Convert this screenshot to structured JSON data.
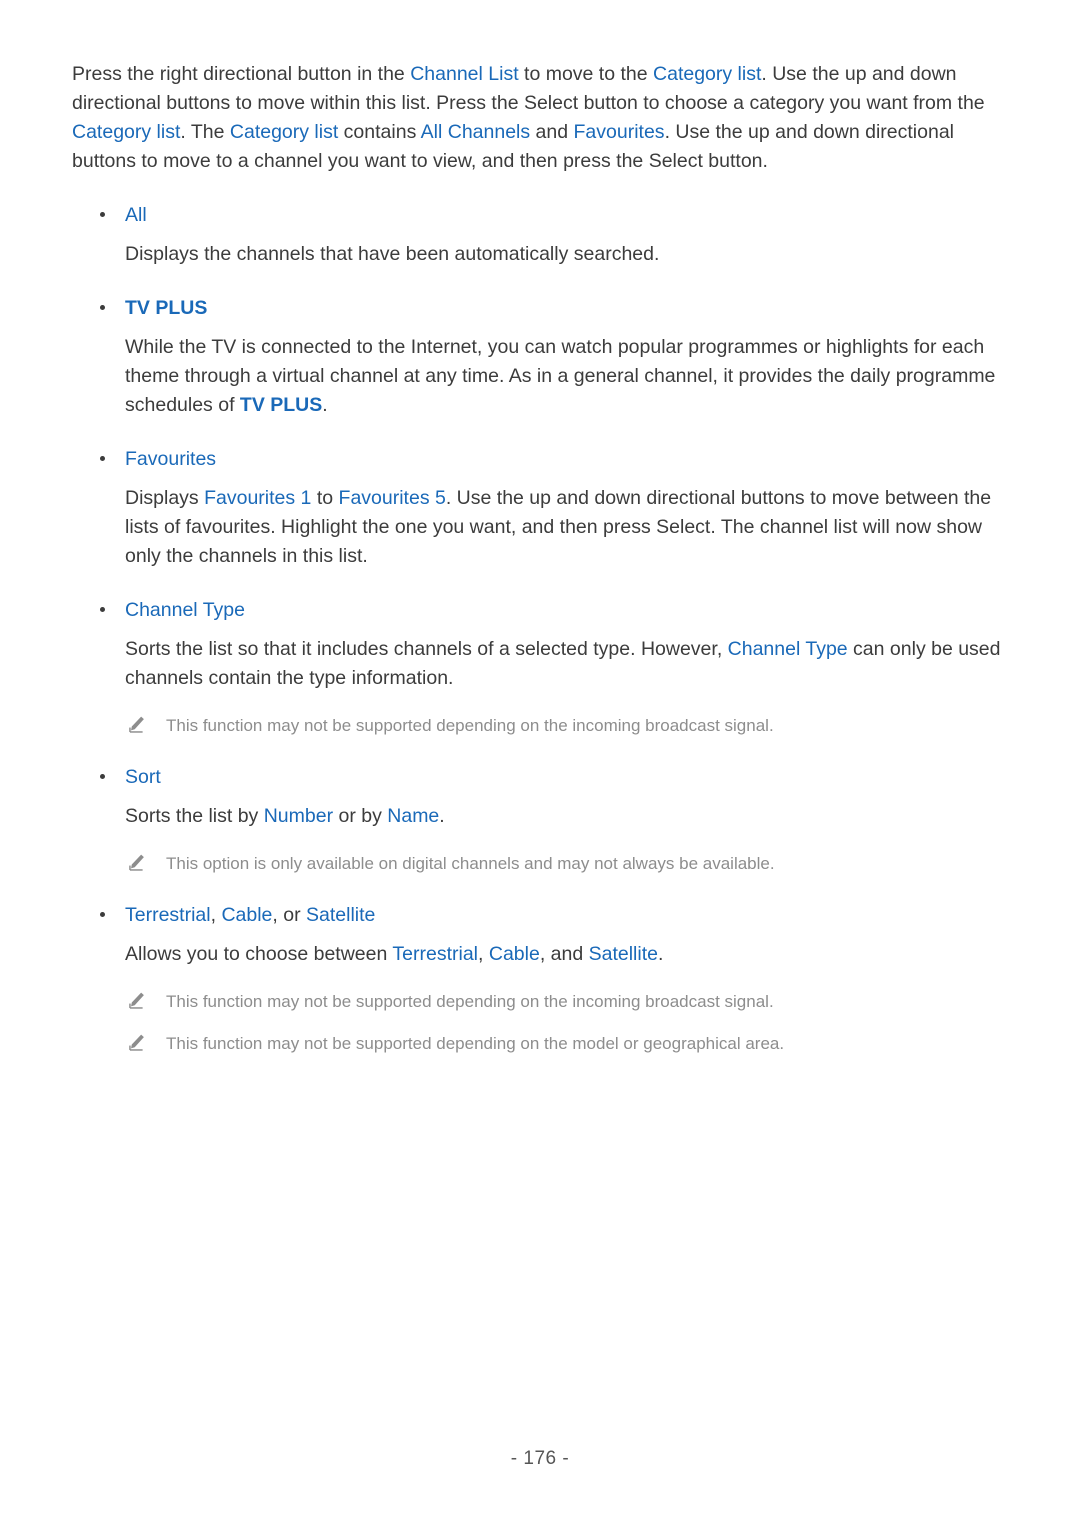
{
  "document": {
    "page_number": "- 176 -",
    "accent_color": "#1a69b8",
    "body_color": "#3c3c3c",
    "note_color": "#8d8d8d"
  },
  "intro": {
    "p1_a": "Press the right directional button in the ",
    "k1": "Channel List",
    "p1_b": " to move to the ",
    "k2": "Category list",
    "p1_c": ". Use the up and down directional buttons to move within this list. Press the Select button to choose a category you want from the ",
    "k3": "Category list",
    "p1_d": ". The ",
    "k4": "Category list",
    "p1_e": " contains ",
    "k5": "All Channels",
    "p1_f": " and ",
    "k6": "Favourites",
    "p1_g": ". Use the up and down directional buttons to move to a channel you want to view, and then press the Select button."
  },
  "sections": {
    "all": {
      "label": "All",
      "body": "Displays the channels that have been automatically searched."
    },
    "tv_plus": {
      "label": "TV PLUS",
      "body_a": "While the TV is connected to the Internet, you can watch popular programmes or highlights for each theme through a virtual channel at any time. As in a general channel, it provides the daily programme schedules of ",
      "body_k": "TV PLUS",
      "body_b": "."
    },
    "favourites": {
      "label": "Favourites",
      "body_a": "Displays ",
      "body_k1": "Favourites 1",
      "body_b": " to ",
      "body_k2": "Favourites 5",
      "body_c": ". Use the up and down directional buttons to move between the lists of favourites. Highlight the one you want, and then press Select. The channel list will now show only the channels in this list."
    },
    "channel_type": {
      "label": "Channel Type",
      "body_a": "Sorts the list so that it includes channels of a selected type. However, ",
      "body_k": "Channel Type",
      "body_b": " can only be used channels contain the type information.",
      "note1": "This function may not be supported depending on the incoming broadcast signal."
    },
    "sort": {
      "label": "Sort",
      "body_a": "Sorts the list by ",
      "body_k1": "Number",
      "body_b": " or by ",
      "body_k2": "Name",
      "body_c": ".",
      "note1": "This option is only available on digital channels and may not always be available."
    },
    "terrestrial": {
      "label_k1": "Terrestrial",
      "label_sep1": ", ",
      "label_k2": "Cable",
      "label_sep2": ", or ",
      "label_k3": "Satellite",
      "body_a": "Allows you to choose between ",
      "body_k1": "Terrestrial",
      "body_b": ", ",
      "body_k2": "Cable",
      "body_c": ", and ",
      "body_k3": "Satellite",
      "body_d": ".",
      "note1": "This function may not be supported depending on the incoming broadcast signal.",
      "note2": "This function may not be supported depending on the model or geographical area."
    }
  }
}
